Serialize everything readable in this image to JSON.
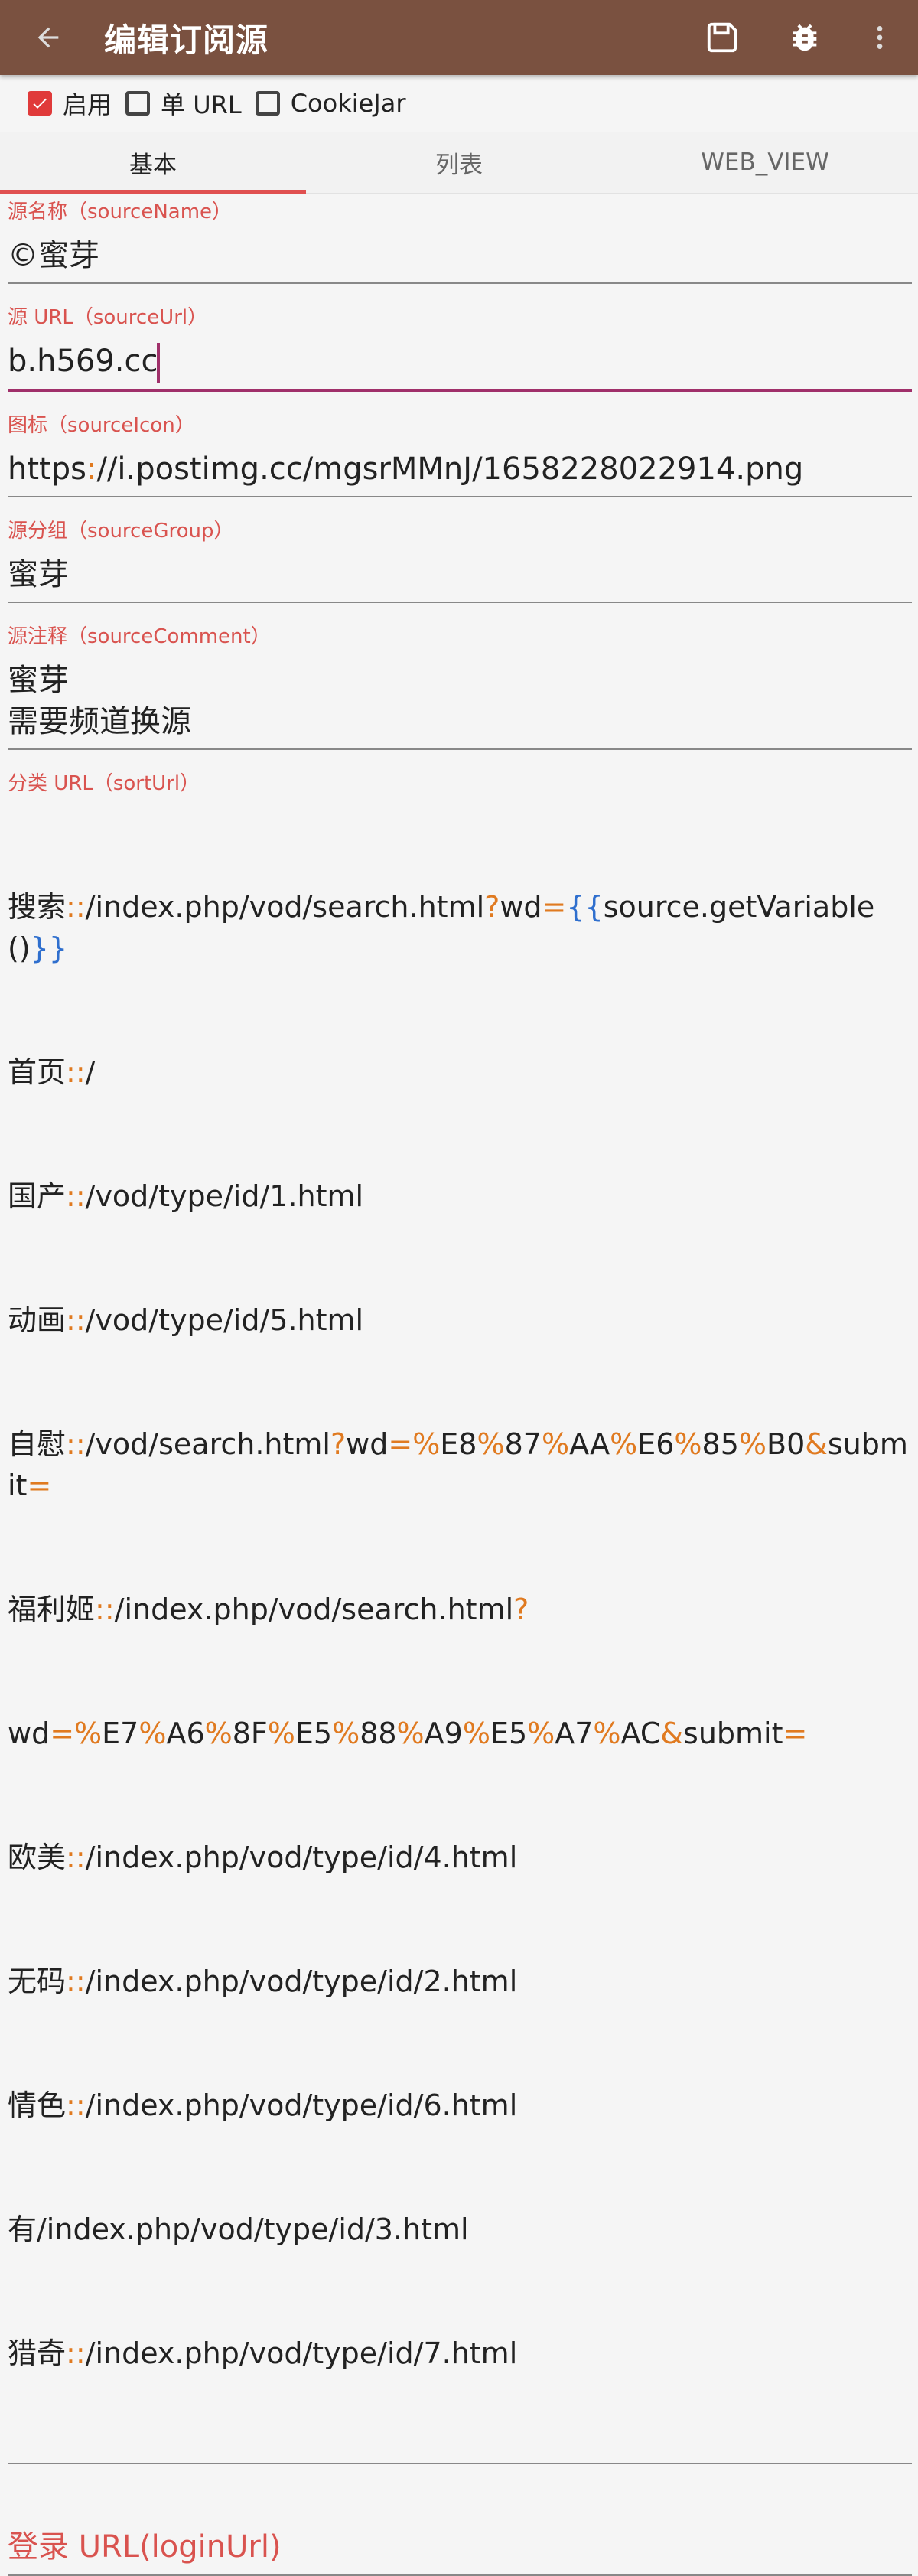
{
  "appbar": {
    "title": "编辑订阅源",
    "back_icon": "arrow-left-icon",
    "save_icon": "save-icon",
    "debug_icon": "bug-icon",
    "more_icon": "more-vert-icon",
    "bg_color": "#7a5140"
  },
  "checks": [
    {
      "label": "启用",
      "checked": true
    },
    {
      "label": "单 URL",
      "checked": false
    },
    {
      "label": "CookieJar",
      "checked": false
    }
  ],
  "tabs": [
    {
      "label": "基本",
      "active": true
    },
    {
      "label": "列表",
      "active": false
    },
    {
      "label": "WEB_VIEW",
      "active": false
    }
  ],
  "fields": {
    "source_name": {
      "label": "源名称（sourceName）",
      "value": "©蜜芽"
    },
    "source_url": {
      "label": "源 URL（sourceUrl）",
      "value": "b.h569.cc"
    },
    "source_icon": {
      "label": "图标（sourceIcon）",
      "value": "https://i.postimg.cc/mgsrMMnJ/1658228022914.png"
    },
    "source_group": {
      "label": "源分组（sourceGroup）",
      "value": "蜜芽"
    },
    "source_comment": {
      "label": "源注释（sourceComment）",
      "value": "蜜芽\n需要频道换源"
    },
    "sort_url": {
      "label": "分类 URL（sortUrl）",
      "lines": [
        "搜索::/index.php/vod/search.html?wd={{source.getVariable()}}",
        "首页::/",
        "国产::/vod/type/id/1.html",
        "动画::/vod/type/id/5.html",
        "自慰::/vod/search.html?wd=%E8%87%AA%E6%85%B0&submit=",
        "福利姬::/index.php/vod/search.html?",
        "wd=%E7%A6%8F%E5%88%A9%E5%A7%AC&submit=",
        "欧美::/index.php/vod/type/id/4.html",
        "无码::/index.php/vod/type/id/2.html",
        "情色::/index.php/vod/type/id/6.html",
        "有/index.php/vod/type/id/3.html",
        "猎奇::/index.php/vod/type/id/7.html"
      ]
    },
    "login_url": {
      "label": "登录 URL(loginUrl)"
    }
  },
  "colors": {
    "label": "#d9534f",
    "accent": "#e03a3a",
    "focus": "#a0306a",
    "syntax_punct": "#e07a20",
    "syntax_brace": "#2f6fce"
  }
}
